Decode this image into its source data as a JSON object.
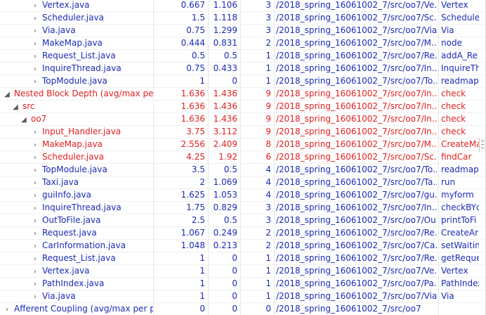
{
  "rows": [
    {
      "name": "Vertex.java",
      "mean": "0.667",
      "max": "1.106",
      "sev": "3",
      "path": "/2018_spring_16061002_7/src/oo7/Ve...",
      "method": "Vertex",
      "tw": "›",
      "indent": 3,
      "color": "blue"
    },
    {
      "name": "Scheduler.java",
      "mean": "1.5",
      "max": "1.118",
      "sev": "3",
      "path": "/2018_spring_16061002_7/src/oo7/Sc...",
      "method": "Schedule",
      "tw": "›",
      "indent": 3,
      "color": "blue"
    },
    {
      "name": "Via.java",
      "mean": "0.75",
      "max": "1.299",
      "sev": "3",
      "path": "/2018_spring_16061002_7/src/oo7/Via...",
      "method": "Via",
      "tw": "›",
      "indent": 3,
      "color": "blue"
    },
    {
      "name": "MakeMap.java",
      "mean": "0.444",
      "max": "0.831",
      "sev": "2",
      "path": "/2018_spring_16061002_7/src/oo7/M...",
      "method": "node",
      "tw": "›",
      "indent": 3,
      "color": "blue"
    },
    {
      "name": "Request_List.java",
      "mean": "0.5",
      "max": "0.5",
      "sev": "1",
      "path": "/2018_spring_16061002_7/src/oo7/Re...",
      "method": "addA_Re",
      "tw": "›",
      "indent": 3,
      "color": "blue"
    },
    {
      "name": "InquireThread.java",
      "mean": "0.75",
      "max": "0.433",
      "sev": "1",
      "path": "/2018_spring_16061002_7/src/oo7/In...",
      "method": "InquireTh",
      "tw": "›",
      "indent": 3,
      "color": "blue"
    },
    {
      "name": "TopModule.java",
      "mean": "1",
      "max": "0",
      "sev": "1",
      "path": "/2018_spring_16061002_7/src/oo7/To...",
      "method": "readmap",
      "tw": "›",
      "indent": 3,
      "color": "blue"
    },
    {
      "name": "Nested Block Depth (avg/max per",
      "mean": "1.636",
      "max": "1.436",
      "sev": "9",
      "path": "/2018_spring_16061002_7/src/oo7/In...",
      "method": "check",
      "tw": "◢",
      "indent": 0,
      "color": "red"
    },
    {
      "name": "src",
      "mean": "1.636",
      "max": "1.436",
      "sev": "9",
      "path": "/2018_spring_16061002_7/src/oo7/In...",
      "method": "check",
      "tw": "◢",
      "indent": 1,
      "color": "red"
    },
    {
      "name": "oo7",
      "mean": "1.636",
      "max": "1.436",
      "sev": "9",
      "path": "/2018_spring_16061002_7/src/oo7/In...",
      "method": "check",
      "tw": "◢",
      "indent": 2,
      "color": "red"
    },
    {
      "name": "Input_Handler.java",
      "mean": "3.75",
      "max": "3.112",
      "sev": "9",
      "path": "/2018_spring_16061002_7/src/oo7/In...",
      "method": "check",
      "tw": "›",
      "indent": 3,
      "color": "red"
    },
    {
      "name": "MakeMap.java",
      "mean": "2.556",
      "max": "2.409",
      "sev": "8",
      "path": "/2018_spring_16061002_7/src/oo7/M...",
      "method": "CreateMa",
      "tw": "›",
      "indent": 3,
      "color": "red"
    },
    {
      "name": "Scheduler.java",
      "mean": "4.25",
      "max": "1.92",
      "sev": "6",
      "path": "/2018_spring_16061002_7/src/oo7/Sc...",
      "method": "findCar",
      "tw": "›",
      "indent": 3,
      "color": "red"
    },
    {
      "name": "TopModule.java",
      "mean": "3.5",
      "max": "0.5",
      "sev": "4",
      "path": "/2018_spring_16061002_7/src/oo7/To...",
      "method": "readmap",
      "tw": "›",
      "indent": 3,
      "color": "blue"
    },
    {
      "name": "Taxi.java",
      "mean": "2",
      "max": "1.069",
      "sev": "4",
      "path": "/2018_spring_16061002_7/src/oo7/Ta...",
      "method": "run",
      "tw": "›",
      "indent": 3,
      "color": "blue"
    },
    {
      "name": "guiInfo.java",
      "mean": "1.625",
      "max": "1.053",
      "sev": "4",
      "path": "/2018_spring_16061002_7/src/oo7/gu...",
      "method": "myform",
      "tw": "›",
      "indent": 3,
      "color": "blue"
    },
    {
      "name": "InquireThread.java",
      "mean": "1.75",
      "max": "0.829",
      "sev": "3",
      "path": "/2018_spring_16061002_7/src/oo7/In...",
      "method": "checkBYc",
      "tw": "›",
      "indent": 3,
      "color": "blue"
    },
    {
      "name": "OutToFile.java",
      "mean": "2.5",
      "max": "0.5",
      "sev": "3",
      "path": "/2018_spring_16061002_7/src/oo7/Ou...",
      "method": "printToFi",
      "tw": "›",
      "indent": 3,
      "color": "blue"
    },
    {
      "name": "Request.java",
      "mean": "1.067",
      "max": "0.249",
      "sev": "2",
      "path": "/2018_spring_16061002_7/src/oo7/Re...",
      "method": "CreateAr",
      "tw": "›",
      "indent": 3,
      "color": "blue"
    },
    {
      "name": "CarInformation.java",
      "mean": "1.048",
      "max": "0.213",
      "sev": "2",
      "path": "/2018_spring_16061002_7/src/oo7/Ca...",
      "method": "setWaitin",
      "tw": "›",
      "indent": 3,
      "color": "blue"
    },
    {
      "name": "Request_List.java",
      "mean": "1",
      "max": "0",
      "sev": "1",
      "path": "/2018_spring_16061002_7/src/oo7/Re...",
      "method": "getReque",
      "tw": "›",
      "indent": 3,
      "color": "blue"
    },
    {
      "name": "Vertex.java",
      "mean": "1",
      "max": "0",
      "sev": "1",
      "path": "/2018_spring_16061002_7/src/oo7/Ve...",
      "method": "Vertex",
      "tw": "›",
      "indent": 3,
      "color": "blue"
    },
    {
      "name": "PathIndex.java",
      "mean": "1",
      "max": "0",
      "sev": "1",
      "path": "/2018_spring_16061002_7/src/oo7/Pa...",
      "method": "PathIndex",
      "tw": "›",
      "indent": 3,
      "color": "blue"
    },
    {
      "name": "Via.java",
      "mean": "1",
      "max": "0",
      "sev": "1",
      "path": "/2018_spring_16061002_7/src/oo7/Via...",
      "method": "Via",
      "tw": "›",
      "indent": 3,
      "color": "blue"
    },
    {
      "name": "Afferent Coupling (avg/max per p",
      "mean": "0",
      "max": "0",
      "sev": "0",
      "path": "/2018_spring_16061002_7/src/oo7",
      "method": "",
      "tw": "›",
      "indent": 0,
      "color": "blue"
    }
  ]
}
